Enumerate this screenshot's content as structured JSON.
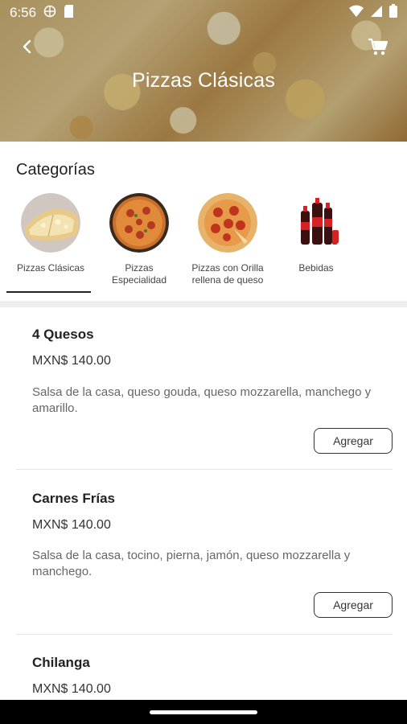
{
  "status": {
    "time": "6:56"
  },
  "header": {
    "title": "Pizzas Clásicas"
  },
  "categories": {
    "heading": "Categorías",
    "items": [
      {
        "label": "Pizzas Clásicas",
        "selected": true
      },
      {
        "label": "Pizzas Especialidad",
        "selected": false
      },
      {
        "label": "Pizzas con Orilla rellena de queso",
        "selected": false
      },
      {
        "label": "Bebidas",
        "selected": false
      }
    ]
  },
  "products": [
    {
      "name": "4 Quesos",
      "price": "MXN$ 140.00",
      "description": "Salsa de la casa, queso gouda, queso mozzarella, manchego y amarillo.",
      "button": "Agregar"
    },
    {
      "name": "Carnes Frías",
      "price": "MXN$ 140.00",
      "description": "Salsa de la casa, tocino, pierna, jamón, queso mozzarella y manchego.",
      "button": "Agregar"
    },
    {
      "name": "Chilanga",
      "price": "MXN$ 140.00"
    }
  ],
  "colors": {
    "accent": "#222222",
    "band": "#eeeeee",
    "text_muted": "#666666"
  }
}
